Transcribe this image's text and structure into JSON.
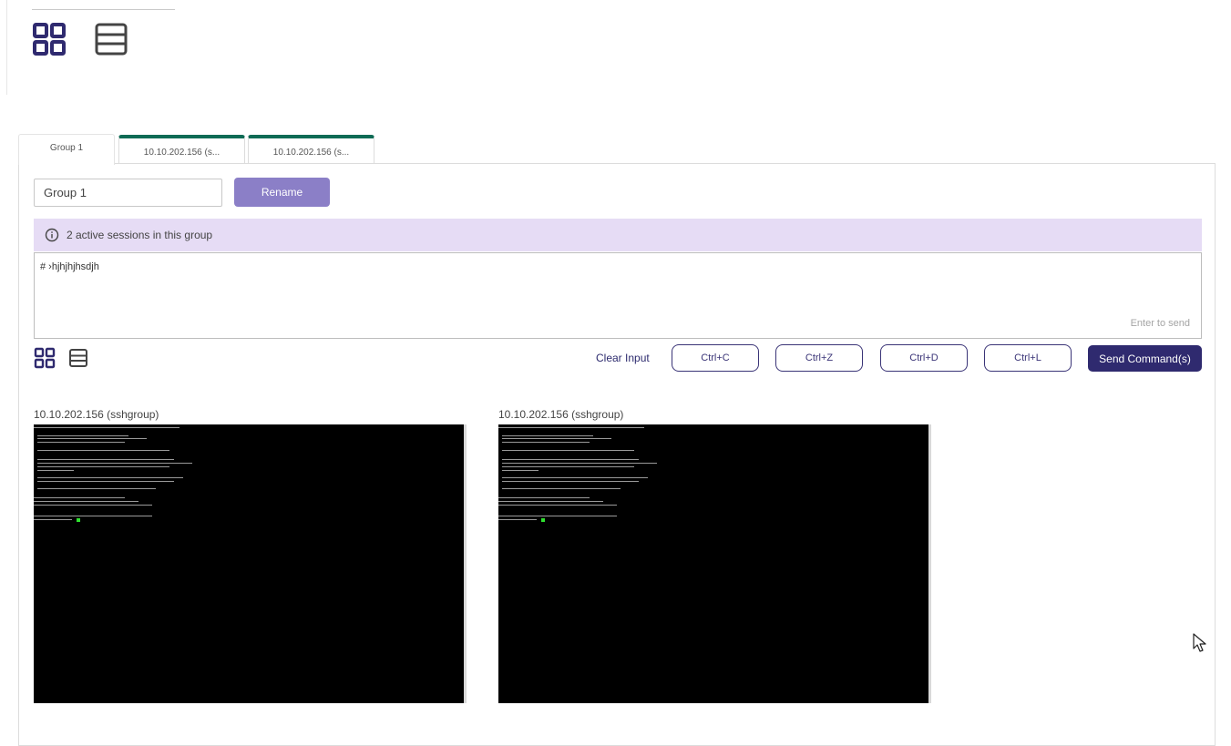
{
  "header": {
    "view_icons": [
      "grid-view-icon",
      "list-view-icon"
    ]
  },
  "tabs": [
    {
      "label": "Group 1",
      "active": true
    },
    {
      "label": "10.10.202.156 (s...",
      "active": false
    },
    {
      "label": "10.10.202.156 (s...",
      "active": false
    }
  ],
  "group": {
    "name_value": "Group 1",
    "rename_label": "Rename"
  },
  "info": {
    "icon": "info-icon",
    "text": "2 active sessions in this group"
  },
  "command": {
    "text": "# ›hjhjhjhsdjh",
    "hint": "Enter to send"
  },
  "toolbar": {
    "clear_input": "Clear Input",
    "ctrl_c": "Ctrl+C",
    "ctrl_z": "Ctrl+Z",
    "ctrl_d": "Ctrl+D",
    "ctrl_l": "Ctrl+L",
    "send": "Send Command(s)"
  },
  "sessions": [
    {
      "title": "10.10.202.156 (sshgroup)"
    },
    {
      "title": "10.10.202.156 (sshgroup)"
    }
  ],
  "colors": {
    "accent_dark": "#2f2a6f",
    "accent_light": "#8b7fc7",
    "info_bg": "#e6dcf5",
    "tab_accent": "#0f6b55",
    "terminal_bg": "#000000",
    "cursor": "#2fe02f"
  }
}
